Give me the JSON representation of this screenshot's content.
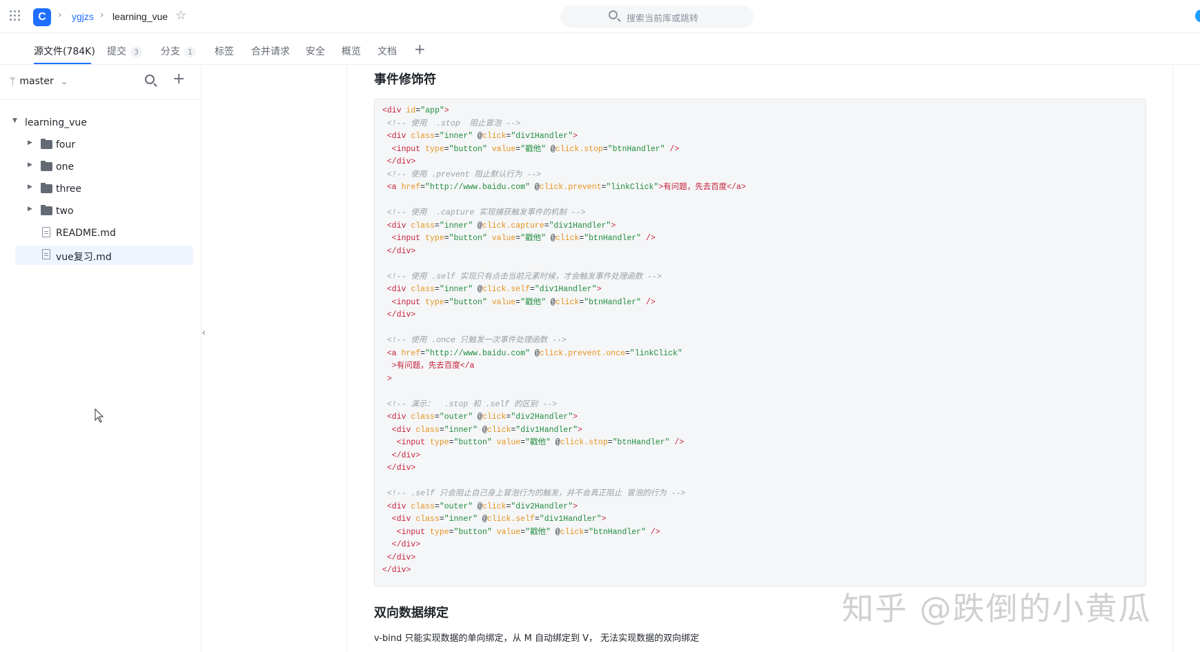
{
  "header": {
    "breadcrumb_owner": "ygjzs",
    "breadcrumb_repo": "learning_vue",
    "logo_letter": "C",
    "search_placeholder": "搜索当前库或跳转"
  },
  "tabs": [
    {
      "label": "源文件(784K)",
      "badge": ""
    },
    {
      "label": "提交",
      "badge": "3"
    },
    {
      "label": "分支",
      "badge": "1"
    },
    {
      "label": "标签",
      "badge": ""
    },
    {
      "label": "合并请求",
      "badge": ""
    },
    {
      "label": "安全",
      "badge": ""
    },
    {
      "label": "概览",
      "badge": ""
    },
    {
      "label": "文档",
      "badge": ""
    }
  ],
  "sidebar": {
    "branch": "master",
    "root": "learning_vue",
    "items": [
      {
        "label": "four",
        "type": "folder"
      },
      {
        "label": "one",
        "type": "folder"
      },
      {
        "label": "three",
        "type": "folder"
      },
      {
        "label": "two",
        "type": "folder"
      },
      {
        "label": "README.md",
        "type": "file"
      },
      {
        "label": "vue复习.md",
        "type": "file",
        "selected": true
      }
    ]
  },
  "content": {
    "heading1": "事件修饰符",
    "heading2": "双向数据绑定",
    "paragraph": "v-bind 只能实现数据的单向绑定，从 M 自动绑定到 V， 无法实现数据的双向绑定",
    "watermark": "知乎 @跌倒的小黄瓜"
  },
  "code_lines": [
    [
      [
        "t",
        "<div"
      ],
      [
        "a",
        " id"
      ],
      [
        "p",
        "="
      ],
      [
        "s",
        "\"app\""
      ],
      [
        "t",
        ">"
      ]
    ],
    [
      [
        "c",
        " <!-- 使用  .stop  阻止冒泡 -->"
      ]
    ],
    [
      [
        "t",
        " <div"
      ],
      [
        "a",
        " class"
      ],
      [
        "p",
        "="
      ],
      [
        "s",
        "\"inner\""
      ],
      [
        "p",
        " @"
      ],
      [
        "a",
        "click"
      ],
      [
        "p",
        "="
      ],
      [
        "s",
        "\"div1Handler\""
      ],
      [
        "t",
        ">"
      ]
    ],
    [
      [
        "t",
        "  <input"
      ],
      [
        "a",
        " type"
      ],
      [
        "p",
        "="
      ],
      [
        "s",
        "\"button\""
      ],
      [
        "a",
        " value"
      ],
      [
        "p",
        "="
      ],
      [
        "s",
        "\"戳他\""
      ],
      [
        "p",
        " @"
      ],
      [
        "a",
        "click.stop"
      ],
      [
        "p",
        "="
      ],
      [
        "s",
        "\"btnHandler\""
      ],
      [
        "t",
        " />"
      ]
    ],
    [
      [
        "t",
        " </div>"
      ]
    ],
    [
      [
        "c",
        " <!-- 使用 .prevent 阻止默认行为 -->"
      ]
    ],
    [
      [
        "t",
        " <a"
      ],
      [
        "a",
        " href"
      ],
      [
        "p",
        "="
      ],
      [
        "s",
        "\"http://www.baidu.com\""
      ],
      [
        "p",
        " @"
      ],
      [
        "a",
        "click.prevent"
      ],
      [
        "p",
        "="
      ],
      [
        "s",
        "\"linkClick\""
      ],
      [
        "t",
        ">"
      ],
      [
        "x",
        "有问题，先去百度"
      ],
      [
        "t",
        "</a>"
      ]
    ],
    [],
    [
      [
        "c",
        " <!-- 使用  .capture 实现捕获触发事件的机制 -->"
      ]
    ],
    [
      [
        "t",
        " <div"
      ],
      [
        "a",
        " class"
      ],
      [
        "p",
        "="
      ],
      [
        "s",
        "\"inner\""
      ],
      [
        "p",
        " @"
      ],
      [
        "a",
        "click.capture"
      ],
      [
        "p",
        "="
      ],
      [
        "s",
        "\"div1Handler\""
      ],
      [
        "t",
        ">"
      ]
    ],
    [
      [
        "t",
        "  <input"
      ],
      [
        "a",
        " type"
      ],
      [
        "p",
        "="
      ],
      [
        "s",
        "\"button\""
      ],
      [
        "a",
        " value"
      ],
      [
        "p",
        "="
      ],
      [
        "s",
        "\"戳他\""
      ],
      [
        "p",
        " @"
      ],
      [
        "a",
        "click"
      ],
      [
        "p",
        "="
      ],
      [
        "s",
        "\"btnHandler\""
      ],
      [
        "t",
        " />"
      ]
    ],
    [
      [
        "t",
        " </div>"
      ]
    ],
    [],
    [
      [
        "c",
        " <!-- 使用 .self 实现只有点击当前元素时候，才会触发事件处理函数 -->"
      ]
    ],
    [
      [
        "t",
        " <div"
      ],
      [
        "a",
        " class"
      ],
      [
        "p",
        "="
      ],
      [
        "s",
        "\"inner\""
      ],
      [
        "p",
        " @"
      ],
      [
        "a",
        "click.self"
      ],
      [
        "p",
        "="
      ],
      [
        "s",
        "\"div1Handler\""
      ],
      [
        "t",
        ">"
      ]
    ],
    [
      [
        "t",
        "  <input"
      ],
      [
        "a",
        " type"
      ],
      [
        "p",
        "="
      ],
      [
        "s",
        "\"button\""
      ],
      [
        "a",
        " value"
      ],
      [
        "p",
        "="
      ],
      [
        "s",
        "\"戳他\""
      ],
      [
        "p",
        " @"
      ],
      [
        "a",
        "click"
      ],
      [
        "p",
        "="
      ],
      [
        "s",
        "\"btnHandler\""
      ],
      [
        "t",
        " />"
      ]
    ],
    [
      [
        "t",
        " </div>"
      ]
    ],
    [],
    [
      [
        "c",
        " <!-- 使用 .once 只触发一次事件处理函数 -->"
      ]
    ],
    [
      [
        "t",
        " <a"
      ],
      [
        "a",
        " href"
      ],
      [
        "p",
        "="
      ],
      [
        "s",
        "\"http://www.baidu.com\""
      ],
      [
        "p",
        " @"
      ],
      [
        "a",
        "click.prevent.once"
      ],
      [
        "p",
        "="
      ],
      [
        "s",
        "\"linkClick\""
      ]
    ],
    [
      [
        "t",
        "  >"
      ],
      [
        "x",
        "有问题，先去百度"
      ],
      [
        "t",
        "</a"
      ]
    ],
    [
      [
        "t",
        " >"
      ]
    ],
    [],
    [
      [
        "c",
        " <!-- 演示：  .stop 和 .self 的区别 -->"
      ]
    ],
    [
      [
        "t",
        " <div"
      ],
      [
        "a",
        " class"
      ],
      [
        "p",
        "="
      ],
      [
        "s",
        "\"outer\""
      ],
      [
        "p",
        " @"
      ],
      [
        "a",
        "click"
      ],
      [
        "p",
        "="
      ],
      [
        "s",
        "\"div2Handler\""
      ],
      [
        "t",
        ">"
      ]
    ],
    [
      [
        "t",
        "  <div"
      ],
      [
        "a",
        " class"
      ],
      [
        "p",
        "="
      ],
      [
        "s",
        "\"inner\""
      ],
      [
        "p",
        " @"
      ],
      [
        "a",
        "click"
      ],
      [
        "p",
        "="
      ],
      [
        "s",
        "\"div1Handler\""
      ],
      [
        "t",
        ">"
      ]
    ],
    [
      [
        "t",
        "   <input"
      ],
      [
        "a",
        " type"
      ],
      [
        "p",
        "="
      ],
      [
        "s",
        "\"button\""
      ],
      [
        "a",
        " value"
      ],
      [
        "p",
        "="
      ],
      [
        "s",
        "\"戳他\""
      ],
      [
        "p",
        " @"
      ],
      [
        "a",
        "click.stop"
      ],
      [
        "p",
        "="
      ],
      [
        "s",
        "\"btnHandler\""
      ],
      [
        "t",
        " />"
      ]
    ],
    [
      [
        "t",
        "  </div>"
      ]
    ],
    [
      [
        "t",
        " </div>"
      ]
    ],
    [],
    [
      [
        "c",
        " <!-- .self 只会阻止自己身上冒泡行为的触发，并不会真正阻止 冒泡的行为 -->"
      ]
    ],
    [
      [
        "t",
        " <div"
      ],
      [
        "a",
        " class"
      ],
      [
        "p",
        "="
      ],
      [
        "s",
        "\"outer\""
      ],
      [
        "p",
        " @"
      ],
      [
        "a",
        "click"
      ],
      [
        "p",
        "="
      ],
      [
        "s",
        "\"div2Handler\""
      ],
      [
        "t",
        ">"
      ]
    ],
    [
      [
        "t",
        "  <div"
      ],
      [
        "a",
        " class"
      ],
      [
        "p",
        "="
      ],
      [
        "s",
        "\"inner\""
      ],
      [
        "p",
        " @"
      ],
      [
        "a",
        "click.self"
      ],
      [
        "p",
        "="
      ],
      [
        "s",
        "\"div1Handler\""
      ],
      [
        "t",
        ">"
      ]
    ],
    [
      [
        "t",
        "   <input"
      ],
      [
        "a",
        " type"
      ],
      [
        "p",
        "="
      ],
      [
        "s",
        "\"button\""
      ],
      [
        "a",
        " value"
      ],
      [
        "p",
        "="
      ],
      [
        "s",
        "\"戳他\""
      ],
      [
        "p",
        " @"
      ],
      [
        "a",
        "click"
      ],
      [
        "p",
        "="
      ],
      [
        "s",
        "\"btnHandler\""
      ],
      [
        "t",
        " />"
      ]
    ],
    [
      [
        "t",
        "  </div>"
      ]
    ],
    [
      [
        "t",
        " </div>"
      ]
    ],
    [
      [
        "t",
        "</div>"
      ]
    ]
  ]
}
